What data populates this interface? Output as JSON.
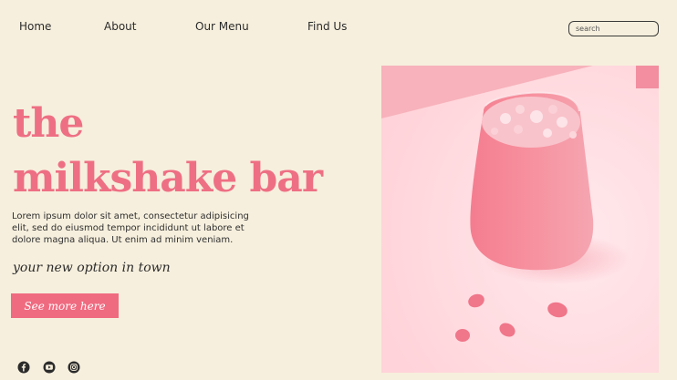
{
  "nav": {
    "items": [
      {
        "label": "Home"
      },
      {
        "label": "About"
      },
      {
        "label": "Our Menu"
      },
      {
        "label": "Find Us"
      }
    ]
  },
  "search": {
    "placeholder": "search"
  },
  "hero": {
    "title_line1": "the",
    "title_line2": "milkshake bar",
    "description": "Lorem ipsum dolor sit amet, consectetur adipisicing elit, sed do eiusmod tempor incididunt ut labore et dolore magna aliqua. Ut enim ad minim veniam.",
    "tagline": "your new option in town",
    "cta_label": "See more here"
  },
  "social": {
    "icons": [
      "facebook-icon",
      "youtube-icon",
      "instagram-icon"
    ]
  },
  "colors": {
    "background": "#f6efdd",
    "accent": "#ee6f83",
    "text": "#2b2b2b"
  }
}
